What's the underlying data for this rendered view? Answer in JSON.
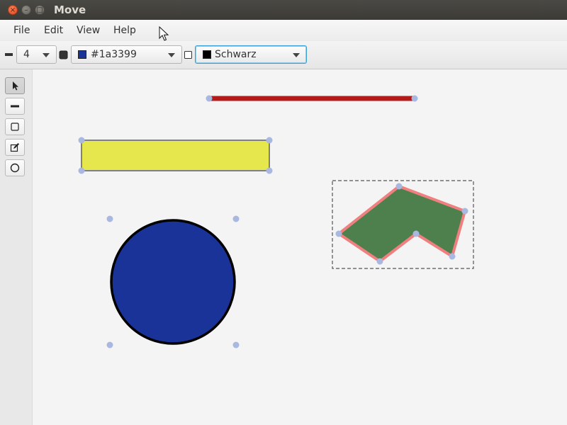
{
  "window": {
    "title": "Move",
    "buttons": {
      "close": "×",
      "minimize": "–",
      "maximize": "□"
    }
  },
  "menubar": {
    "items": [
      {
        "label": "File"
      },
      {
        "label": "Edit"
      },
      {
        "label": "View"
      },
      {
        "label": "Help"
      }
    ]
  },
  "toolbar": {
    "stroke_width": {
      "value": "4",
      "icon": "line-width-icon"
    },
    "fill_color": {
      "value": "#1a3399",
      "swatch": "#1a3399",
      "icon": "filled-square-icon"
    },
    "stroke_color": {
      "value": "Schwarz",
      "swatch": "#000000",
      "icon": "empty-square-icon"
    }
  },
  "tools": [
    {
      "name": "select",
      "icon": "arrow-pointer-icon",
      "active": true
    },
    {
      "name": "line",
      "icon": "line-icon",
      "active": false
    },
    {
      "name": "rectangle",
      "icon": "rectangle-icon",
      "active": false
    },
    {
      "name": "freehand",
      "icon": "pencil-edit-icon",
      "active": false
    },
    {
      "name": "circle",
      "icon": "circle-icon",
      "active": false
    }
  ],
  "colors": {
    "line_shape": "#b31a1a",
    "rectangle_fill": "#e6e64d",
    "rectangle_stroke": "#808080",
    "circle_fill": "#1a3399",
    "circle_stroke": "#000000",
    "polygon_fill": "#4d804d",
    "polygon_stroke": "#f08080",
    "handle": "#a8b8e0",
    "selection_border": "#555555"
  }
}
